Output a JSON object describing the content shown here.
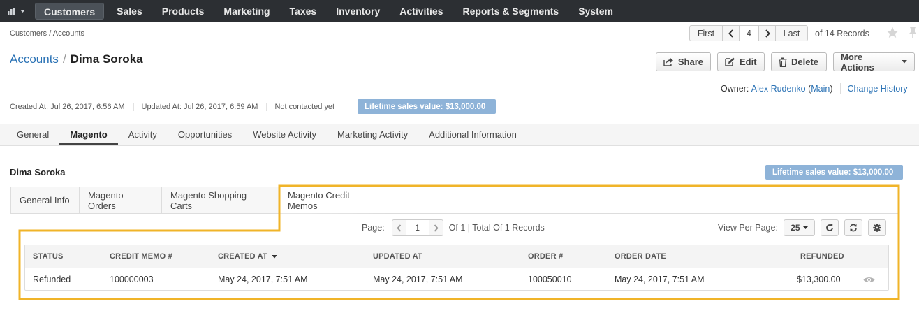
{
  "nav": {
    "items": [
      "Customers",
      "Sales",
      "Products",
      "Marketing",
      "Taxes",
      "Inventory",
      "Activities",
      "Reports & Segments",
      "System"
    ],
    "active_index": 0
  },
  "breadcrumb": "Customers / Accounts",
  "pager": {
    "first": "First",
    "current": "4",
    "last": "Last",
    "records": "of 14 Records"
  },
  "header": {
    "parent": "Accounts",
    "separator": "/",
    "name": "Dima Soroka"
  },
  "actions": {
    "share": "Share",
    "edit": "Edit",
    "delete": "Delete",
    "more": "More Actions"
  },
  "owner": {
    "label": "Owner:",
    "name": "Alex Rudenko",
    "unit": "(Main)",
    "change_history": "Change History"
  },
  "meta": {
    "created": "Created At: Jul 26, 2017, 6:56 AM",
    "updated": "Updated At: Jul 26, 2017, 6:59 AM",
    "contacted": "Not contacted yet",
    "lifetime": "Lifetime sales value: $13,000.00"
  },
  "section_tabs": [
    "General",
    "Magento",
    "Activity",
    "Opportunities",
    "Website Activity",
    "Marketing Activity",
    "Additional Information"
  ],
  "section_active": 1,
  "content": {
    "name": "Dima Soroka",
    "lifetime": "Lifetime sales value: $13,000.00"
  },
  "sub_tabs": [
    "General Info",
    "Magento Orders",
    "Magento Shopping Carts",
    "Magento Credit Memos"
  ],
  "sub_active": 3,
  "grid_tools": {
    "page_label": "Page:",
    "page_value": "1",
    "of_text": "Of 1 | Total Of 1 Records",
    "per_page_label": "View Per Page:",
    "per_page_value": "25"
  },
  "grid": {
    "columns": [
      "STATUS",
      "CREDIT MEMO #",
      "CREATED AT",
      "UPDATED AT",
      "ORDER #",
      "ORDER DATE",
      "REFUNDED"
    ],
    "rows": [
      [
        "Refunded",
        "100000003",
        "May 24, 2017, 7:51 AM",
        "May 24, 2017, 7:51 AM",
        "100050010",
        "May 24, 2017, 7:51 AM",
        "$13,300.00"
      ]
    ]
  },
  "colors": {
    "nav_bg": "#2c2f33",
    "link": "#2a72b5",
    "lifetime_badge": "#8eb3d8",
    "highlight": "#f0b429"
  }
}
